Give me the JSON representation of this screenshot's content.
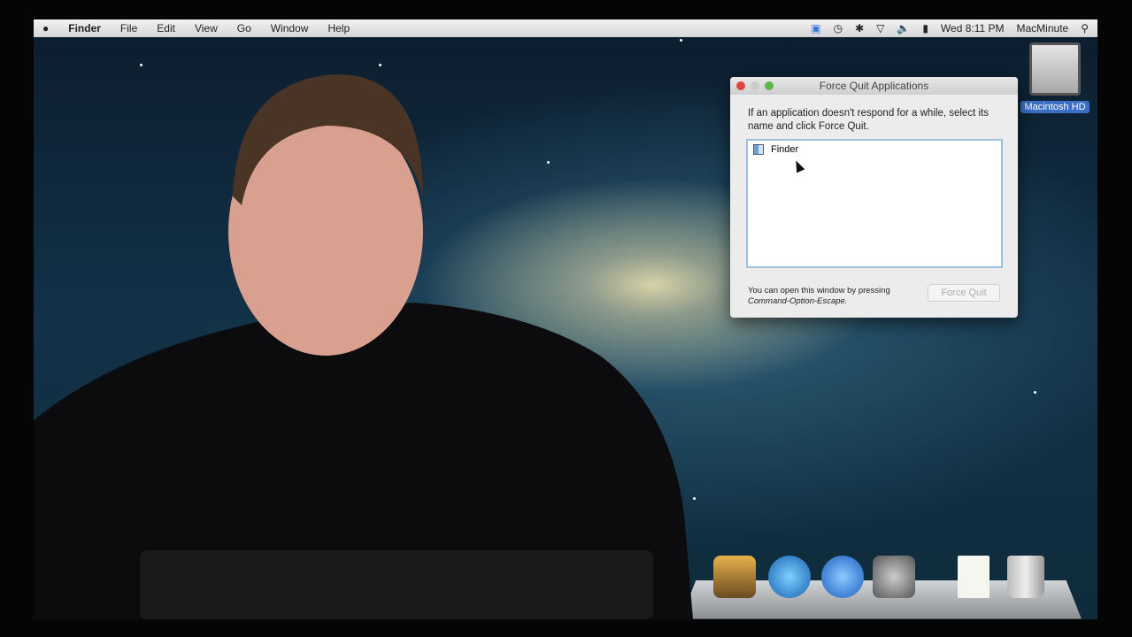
{
  "menubar": {
    "apple": "",
    "items": [
      "Finder",
      "File",
      "Edit",
      "View",
      "Go",
      "Window",
      "Help"
    ],
    "clock": "Wed 8:11 PM",
    "user": "MacMinute"
  },
  "desktop_icon": {
    "label": "Macintosh HD"
  },
  "dialog": {
    "title": "Force Quit Applications",
    "message": "If an application doesn't respond for a while, select its name and click Force Quit.",
    "apps": [
      "Finder"
    ],
    "hint_line1": "You can open this window by pressing",
    "hint_line2": "Command-Option-Escape.",
    "button": "Force Quit"
  },
  "dock": {
    "icons": [
      "iphoto",
      "itunes",
      "app-store",
      "system-preferences",
      "document",
      "trash"
    ]
  }
}
